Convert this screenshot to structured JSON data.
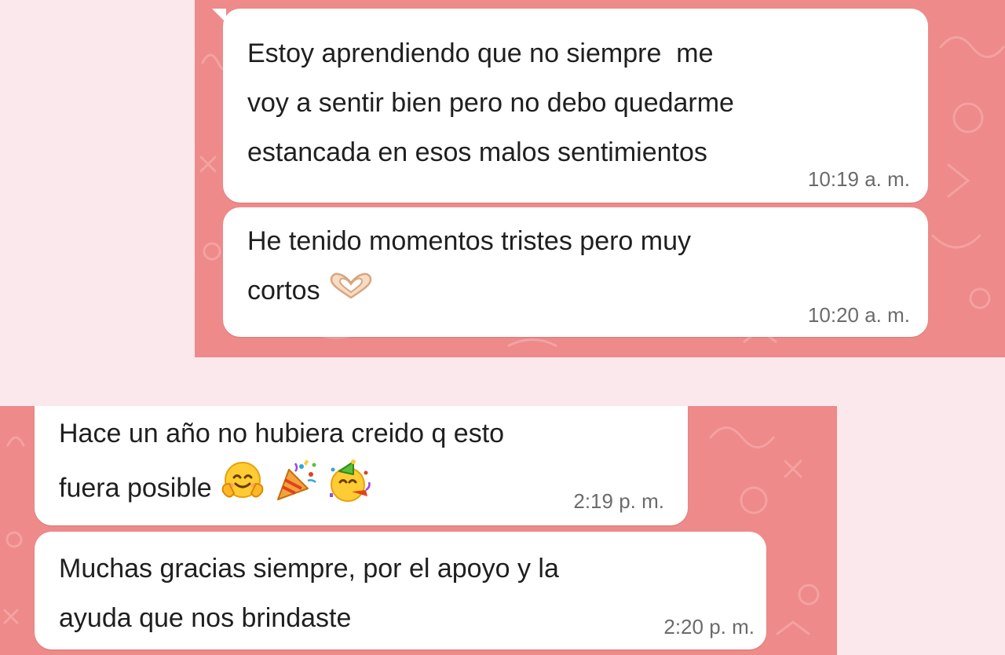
{
  "conversations": [
    {
      "messages": [
        {
          "text": "Estoy aprendiendo que no siempre  me\nvoy a sentir bien pero no debo quedarme\nestancada en esos malos sentimientos",
          "time": "10:19 a. m."
        },
        {
          "text": "He tenido momentos tristes pero muy\ncortos",
          "time": "10:20 a. m.",
          "emojis": [
            "heart-hands-emoji"
          ]
        }
      ]
    },
    {
      "messages": [
        {
          "text": "Hace un año no hubiera creido q esto\nfuera posible",
          "time": "2:19 p. m.",
          "emojis": [
            "hugging-face-emoji",
            "party-popper-emoji",
            "partying-face-emoji"
          ]
        },
        {
          "text": "Muchas gracias siempre, por el apoyo y la\nayuda que nos brindaste",
          "time": "2:20 p. m."
        }
      ]
    }
  ],
  "colors": {
    "page_background": "#fbe8ec",
    "chat_background": "#ee8a8a",
    "bubble": "#ffffff",
    "message_text": "#1f1f1f",
    "timestamp_text": "#6b6b6b"
  }
}
